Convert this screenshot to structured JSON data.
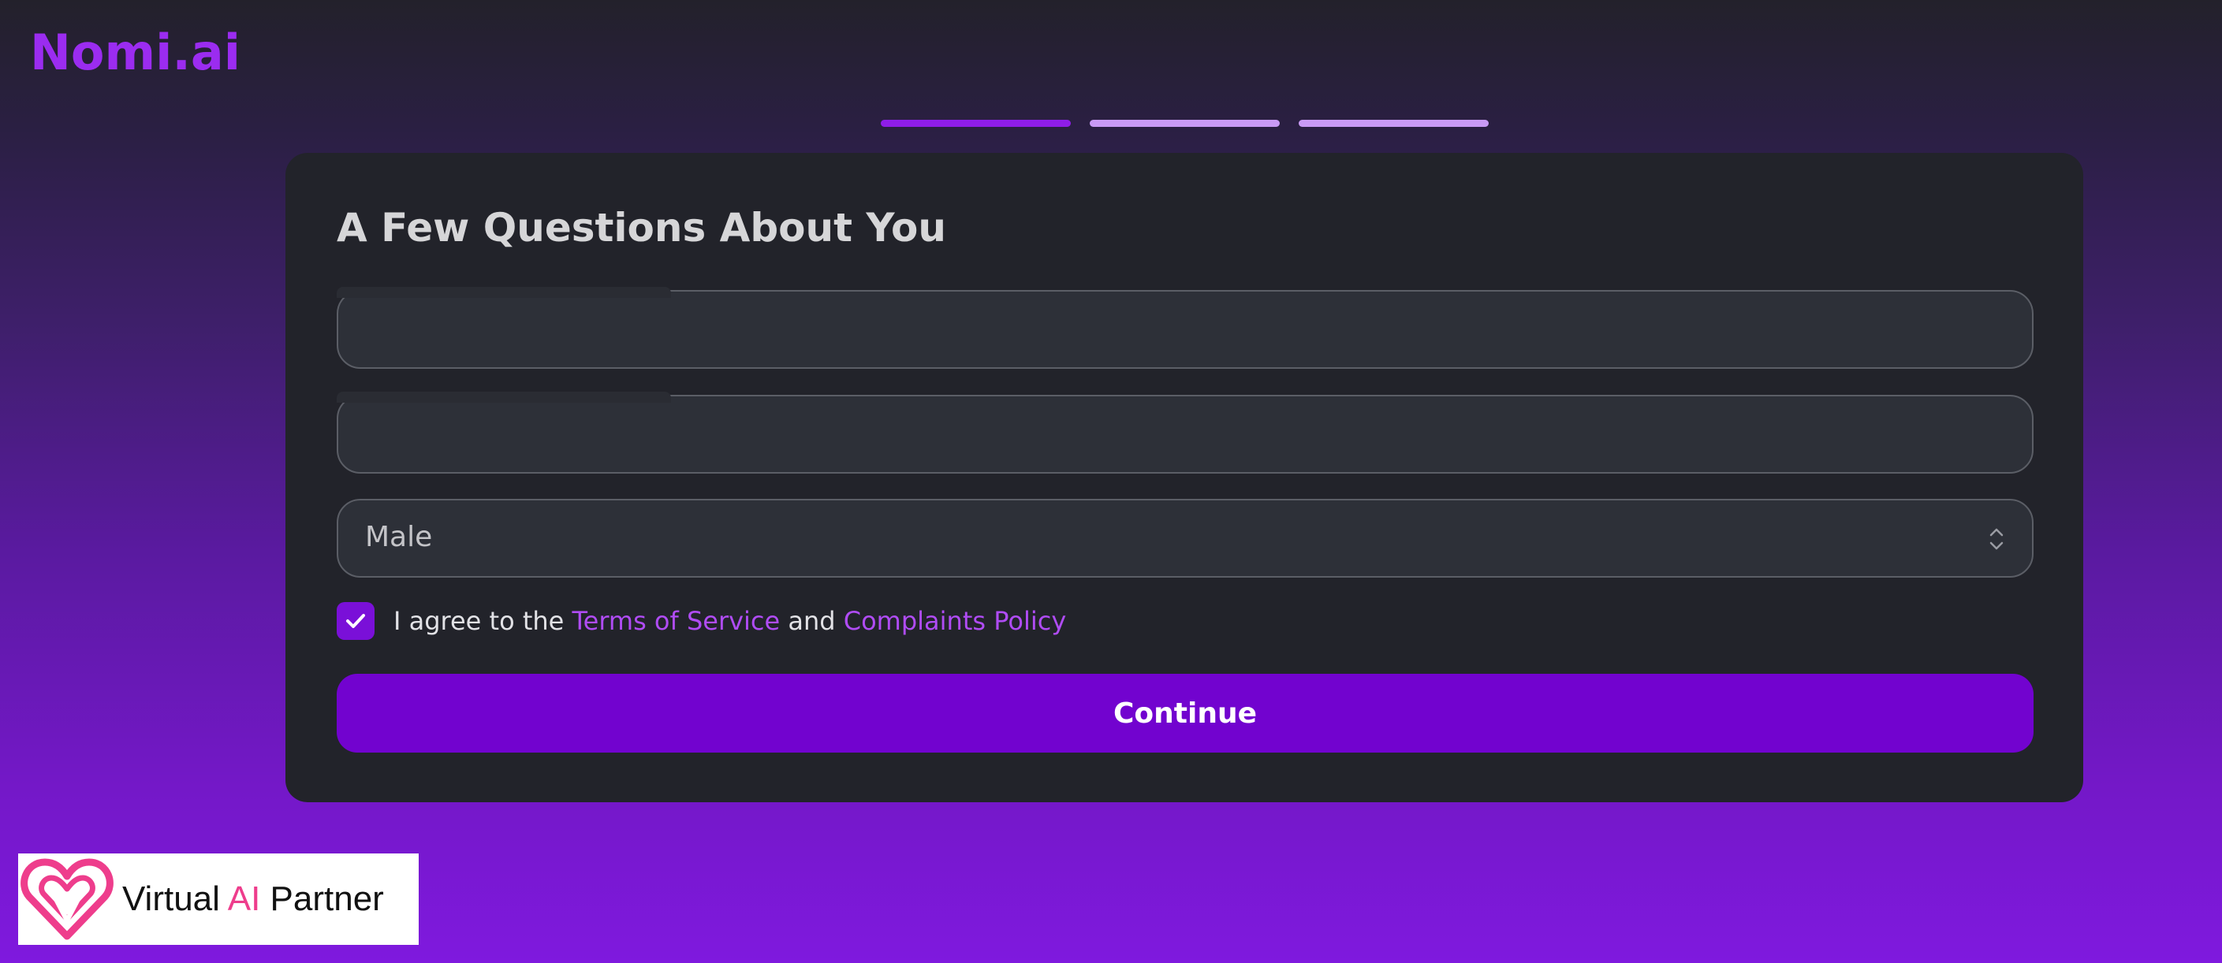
{
  "brand": {
    "name": "Nomi.ai",
    "color": "#9b2cf0"
  },
  "progress": {
    "steps": 3,
    "current": 1,
    "active_color": "#8e1de8",
    "inactive_color": "#c99af5"
  },
  "form": {
    "title": "A Few Questions About You",
    "field1_value": "",
    "field2_value": "",
    "gender_select": {
      "value": "Male",
      "icon": "chevron-up-down-icon"
    },
    "agree": {
      "checked": true,
      "prefix": "I agree to the",
      "terms_link": "Terms of Service",
      "connector": "and",
      "policy_link": "Complaints Policy"
    },
    "continue_label": "Continue",
    "accent_color": "#7203cf"
  },
  "badge": {
    "text_before": "Virtual",
    "text_ai": "AI",
    "text_after": "Partner",
    "icon": "heart-logo-icon"
  }
}
